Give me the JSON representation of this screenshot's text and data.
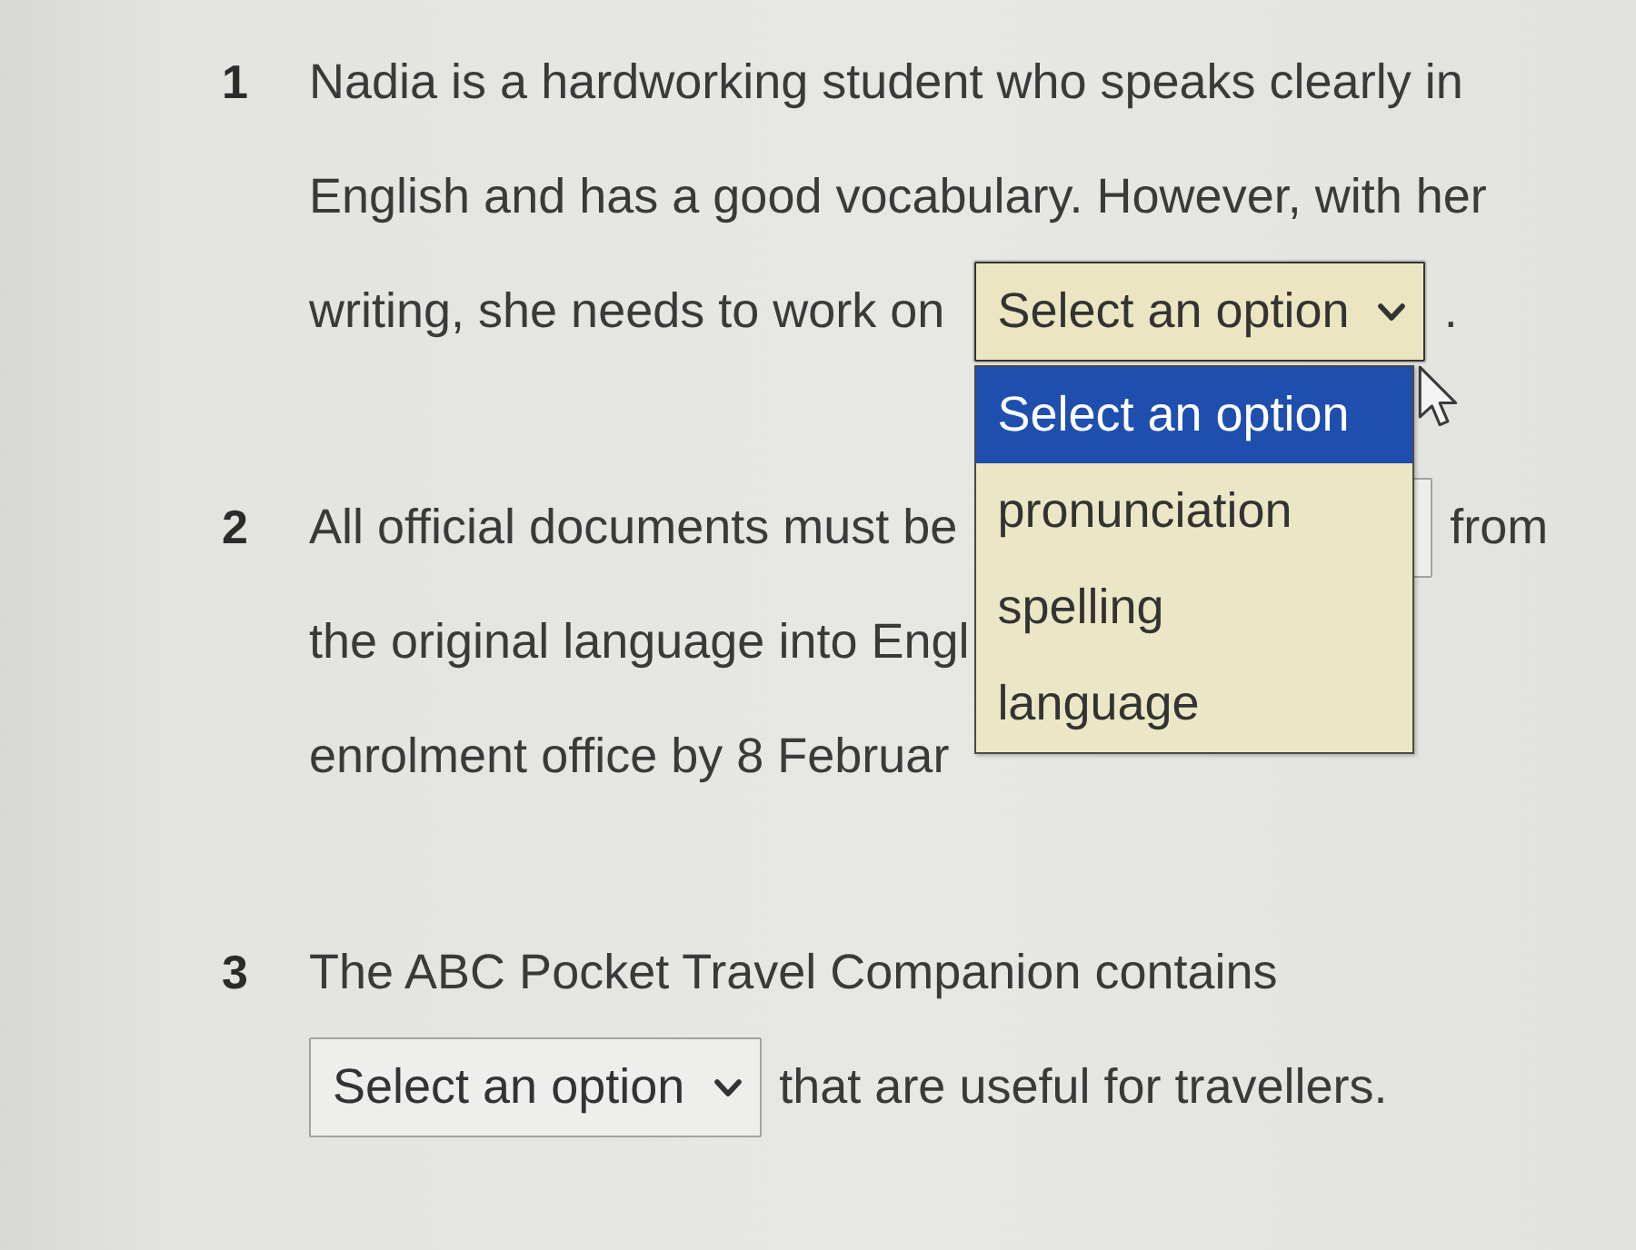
{
  "questions": [
    {
      "number": "1",
      "lines": [
        [
          {
            "kind": "text",
            "text": "Nadia is a hardworking student who speaks clearly in"
          }
        ],
        [
          {
            "kind": "text",
            "text": "English and has a good vocabulary. However, with her"
          }
        ],
        [
          {
            "kind": "text",
            "text": "writing, she needs to work on"
          },
          {
            "kind": "select",
            "value": "Select an option",
            "open": true,
            "options": [
              {
                "label": "Select an option",
                "selected": true
              },
              {
                "label": "pronunciation",
                "selected": false
              },
              {
                "label": "spelling",
                "selected": false
              },
              {
                "label": "language",
                "selected": false
              }
            ]
          },
          {
            "kind": "text",
            "text": "."
          }
        ]
      ]
    },
    {
      "number": "2",
      "lines": [
        [
          {
            "kind": "text",
            "text": "All official documents must be"
          },
          {
            "kind": "select",
            "open": false
          },
          {
            "kind": "text",
            "text": "from"
          }
        ],
        [
          {
            "kind": "text",
            "text": "the original language into Engl"
          }
        ],
        [
          {
            "kind": "text",
            "text": "enrolment office by 8 Februar"
          }
        ]
      ]
    },
    {
      "number": "3",
      "lines": [
        [
          {
            "kind": "text",
            "text": "The ABC Pocket Travel Companion contains"
          }
        ],
        [
          {
            "kind": "select",
            "value": "Select an option",
            "open": false
          },
          {
            "kind": "text",
            "text": "that are useful for travellers."
          }
        ]
      ]
    }
  ]
}
